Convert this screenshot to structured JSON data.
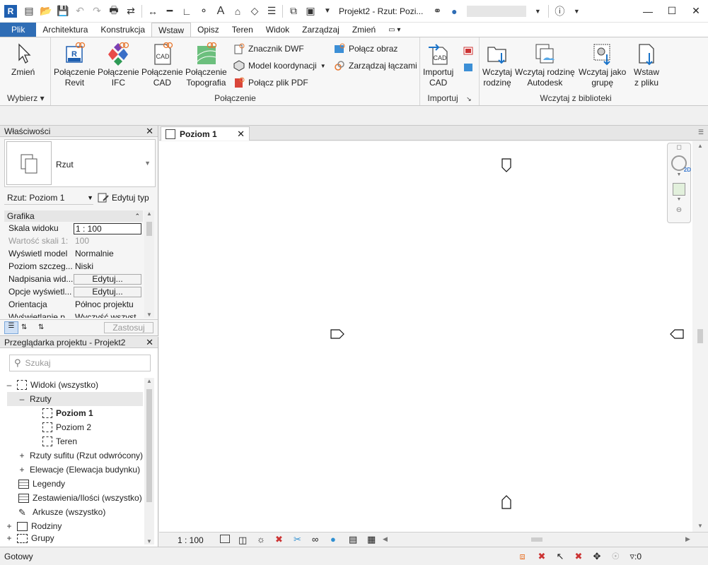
{
  "app": {
    "logo_letter": "R",
    "title": "Projekt2 - Rzut: Pozi...",
    "accent": "#2f6db5"
  },
  "ribbon_tabs": [
    {
      "label": "Plik"
    },
    {
      "label": "Architektura"
    },
    {
      "label": "Konstrukcja"
    },
    {
      "label": "Wstaw"
    },
    {
      "label": "Opisz"
    },
    {
      "label": "Teren"
    },
    {
      "label": "Widok"
    },
    {
      "label": "Zarządzaj"
    },
    {
      "label": "Zmień"
    }
  ],
  "active_tab": "Wstaw",
  "ribbon": {
    "select_panel": {
      "modify": "Zmień",
      "title": "Wybierz"
    },
    "link_panel": {
      "title": "Połączenie",
      "revit": [
        "Połączenie",
        "Revit"
      ],
      "ifc": [
        "Połączenie",
        "IFC"
      ],
      "cad": [
        "Połączenie",
        "CAD"
      ],
      "topo": [
        "Połączenie",
        "Topografia"
      ],
      "dwf": "Znacznik DWF",
      "coord": "Model koordynacji",
      "pdf": "Połącz plik PDF",
      "image": "Połącz obraz",
      "manage": "Zarządzaj łączami"
    },
    "import_panel": {
      "title": "Importuj",
      "cad": [
        "Importuj",
        "CAD"
      ]
    },
    "library_panel": {
      "title": "Wczytaj z biblioteki",
      "family": [
        "Wczytaj",
        "rodzinę"
      ],
      "autodesk": [
        "Wczytaj rodzinę",
        "Autodesk"
      ],
      "group": [
        "Wczytaj jako",
        "grupę"
      ],
      "from_file": [
        "Wstaw",
        "z pliku"
      ]
    }
  },
  "properties": {
    "title": "Właściwości",
    "type_name": "Rzut",
    "instance": "Rzut: Poziom 1",
    "edit_type": "Edytuj typ",
    "section": "Grafika",
    "rows": [
      {
        "k": "Skala widoku",
        "v": "1 : 100"
      },
      {
        "k": "Wartość skali   1:",
        "v": "100"
      },
      {
        "k": "Wyświetl model",
        "v": "Normalnie"
      },
      {
        "k": "Poziom szczeg...",
        "v": "Niski"
      },
      {
        "k": "Nadpisania wid...",
        "v": "Edytuj..."
      },
      {
        "k": "Opcje wyświetl...",
        "v": "Edytuj..."
      },
      {
        "k": "Orientacja",
        "v": "Północ projektu"
      },
      {
        "k": "Wyświetlanie p...",
        "v": "Wyczyść wszyst..."
      }
    ],
    "apply": "Zastosuj"
  },
  "browser": {
    "title": "Przeglądarka projektu - Projekt2",
    "search_placeholder": "Szukaj",
    "items": [
      {
        "label": "Widoki (wszystko)"
      },
      {
        "label": "Rzuty"
      },
      {
        "label": "Poziom 1"
      },
      {
        "label": "Poziom 2"
      },
      {
        "label": "Teren"
      },
      {
        "label": "Rzuty sufitu (Rzut odwrócony)"
      },
      {
        "label": "Elewacje (Elewacja budynku)"
      },
      {
        "label": "Legendy"
      },
      {
        "label": "Zestawienia/Ilości (wszystko)"
      },
      {
        "label": "Arkusze (wszystko)"
      },
      {
        "label": "Rodziny"
      },
      {
        "label": "Grupy"
      }
    ]
  },
  "view": {
    "tab": "Poziom 1",
    "scale": "1 : 100",
    "nav_2d": "2D"
  },
  "status": {
    "text": "Gotowy",
    "filter_count": ":0"
  }
}
